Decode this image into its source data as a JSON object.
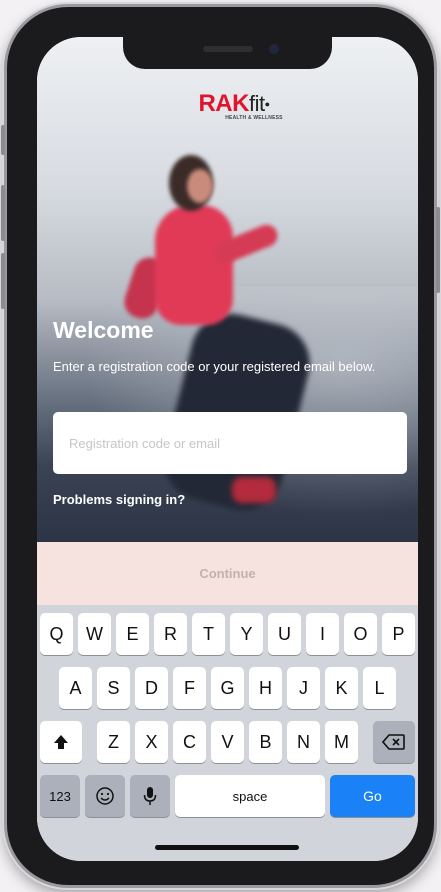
{
  "logo": {
    "brand_main": "RAK",
    "brand_fit": "fit",
    "tagline": "HEALTH & WELLNESS"
  },
  "welcome": {
    "title": "Welcome",
    "instructions": "Enter a registration code or your registered email below."
  },
  "input": {
    "placeholder": "Registration code or email",
    "value": ""
  },
  "problems_link": "Problems signing in?",
  "continue_label": "Continue",
  "keyboard": {
    "row1": [
      "Q",
      "W",
      "E",
      "R",
      "T",
      "Y",
      "U",
      "I",
      "O",
      "P"
    ],
    "row2": [
      "A",
      "S",
      "D",
      "F",
      "G",
      "H",
      "J",
      "K",
      "L"
    ],
    "row3": [
      "Z",
      "X",
      "C",
      "V",
      "B",
      "N",
      "M"
    ],
    "numbers_key": "123",
    "space_key": "space",
    "go_key": "Go"
  },
  "colors": {
    "brand_red": "#e0152d",
    "continue_disabled_bg": "#f6e2de",
    "go_blue": "#1a82f6"
  }
}
